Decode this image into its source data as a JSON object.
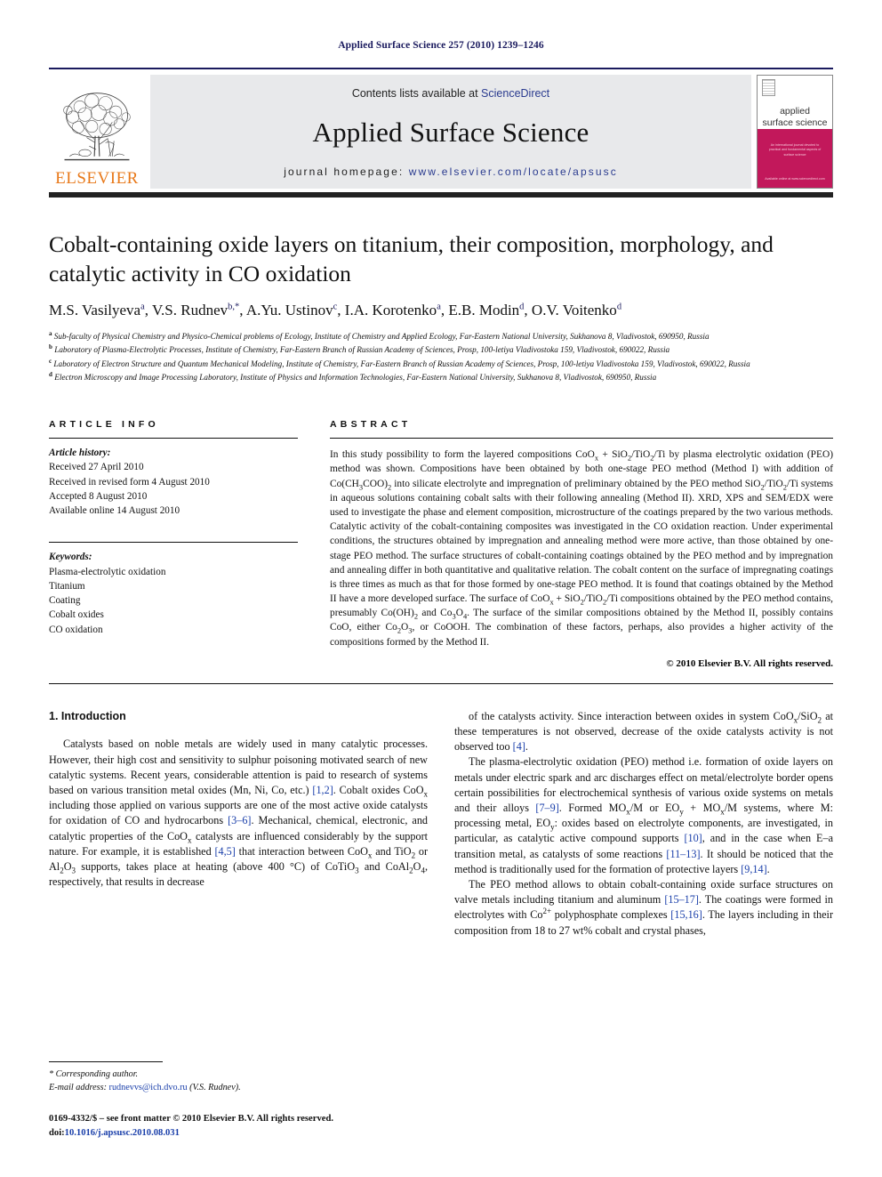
{
  "running_head": "Applied Surface Science 257 (2010) 1239–1246",
  "masthead": {
    "contents_prefix": "Contents lists available at ",
    "contents_link": "ScienceDirect",
    "journal_title": "Applied Surface Science",
    "homepage_prefix": "journal homepage: ",
    "homepage_url": "www.elsevier.com/locate/apsusc",
    "publisher": "ELSEVIER",
    "cover": {
      "line1": "applied",
      "line2": "surface science",
      "sub": "An international journal devoted to practical and fundamental aspects of surface science",
      "foot": "Available online at www.sciencedirect.com"
    }
  },
  "article": {
    "title": "Cobalt-containing oxide layers on titanium, their composition, morphology, and catalytic activity in CO oxidation",
    "authors_html": "M.S. Vasilyeva<sup>a</sup>, V.S. Rudnev<sup>b,*</sup>, A.Yu. Ustinov<sup>c</sup>, I.A. Korotenko<sup>a</sup>, E.B. Modin<sup>d</sup>, O.V. Voitenko<sup>d</sup>",
    "affiliations": [
      {
        "mark": "a",
        "text": "Sub-faculty of Physical Chemistry and Physico-Chemical problems of Ecology, Institute of Chemistry and Applied Ecology, Far-Eastern National University, Sukhanova 8, Vladivostok, 690950, Russia"
      },
      {
        "mark": "b",
        "text": "Laboratory of Plasma-Electrolytic Processes, Institute of Chemistry, Far-Eastern Branch of Russian Academy of Sciences, Prosp, 100-letiya Vladivostoka 159, Vladivostok, 690022, Russia"
      },
      {
        "mark": "c",
        "text": "Laboratory of Electron Structure and Quantum Mechanical Modeling, Institute of Chemistry, Far-Eastern Branch of Russian Academy of Sciences, Prosp, 100-letiya Vladivostoka 159, Vladivostok, 690022, Russia"
      },
      {
        "mark": "d",
        "text": "Electron Microscopy and Image Processing Laboratory, Institute of Physics and Information Technologies, Far-Eastern National University, Sukhanova 8, Vladivostok, 690950, Russia"
      }
    ]
  },
  "article_info": {
    "heading": "ARTICLE INFO",
    "history_label": "Article history:",
    "history": [
      "Received 27 April 2010",
      "Received in revised form 4 August 2010",
      "Accepted 8 August 2010",
      "Available online 14 August 2010"
    ],
    "keywords_label": "Keywords:",
    "keywords": [
      "Plasma-electrolytic oxidation",
      "Titanium",
      "Coating",
      "Cobalt oxides",
      "CO oxidation"
    ]
  },
  "abstract": {
    "heading": "ABSTRACT",
    "text_html": "In this study possibility to form the layered compositions CoO<sub>x</sub> + SiO<sub>2</sub>/TiO<sub>2</sub>/Ti by plasma electrolytic oxidation (PEO) method was shown. Compositions have been obtained by both one-stage PEO method (Method I) with addition of Co(CH<sub>3</sub>COO)<sub>2</sub> into silicate electrolyte and impregnation of preliminary obtained by the PEO method SiO<sub>2</sub>/TiO<sub>2</sub>/Ti systems in aqueous solutions containing cobalt salts with their following annealing (Method II). XRD, XPS and SEM/EDX were used to investigate the phase and element composition, microstructure of the coatings prepared by the two various methods. Catalytic activity of the cobalt-containing composites was investigated in the CO oxidation reaction. Under experimental conditions, the structures obtained by impregnation and annealing method were more active, than those obtained by one-stage PEO method. The surface structures of cobalt-containing coatings obtained by the PEO method and by impregnation and annealing differ in both quantitative and qualitative relation. The cobalt content on the surface of impregnating coatings is three times as much as that for those formed by one-stage PEO method. It is found that coatings obtained by the Method II have a more developed surface. The surface of CoO<sub>x</sub> + SiO<sub>2</sub>/TiO<sub>2</sub>/Ti compositions obtained by the PEO method contains, presumably Co(OH)<sub>2</sub> and Co<sub>3</sub>O<sub>4</sub>. The surface of the similar compositions obtained by the Method II, possibly contains CoO, either Co<sub>2</sub>O<sub>3</sub>, or CoOOH. The combination of these factors, perhaps, also provides a higher activity of the compositions formed by the Method II.",
    "copyright": "© 2010 Elsevier B.V. All rights reserved."
  },
  "intro": {
    "heading": "1.  Introduction",
    "left_html": "Catalysts based on noble metals are widely used in many catalytic processes. However, their high cost and sensitivity to sulphur poisoning motivated search of new catalytic systems. Recent years, considerable attention is paid to research of systems based on various transition metal oxides (Mn, Ni, Co, etc.) <span class=\"ref\">[1,2]</span>. Cobalt oxides CoO<sub>x</sub> including those applied on various supports are one of the most active oxide catalysts for oxidation of CO and hydrocarbons <span class=\"ref\">[3–6]</span>. Mechanical, chemical, electronic, and catalytic properties of the CoO<sub>x</sub> catalysts are influenced considerably by the support nature. For example, it is established <span class=\"ref\">[4,5]</span> that interaction between CoO<sub>x</sub> and TiO<sub>2</sub> or Al<sub>2</sub>O<sub>3</sub> supports, takes place at heating (above 400 °C) of CoTiO<sub>3</sub> and CoAl<sub>2</sub>O<sub>4</sub>, respectively, that results in decrease",
    "right_p1_html": "of the catalysts activity. Since interaction between oxides in system CoO<sub>x</sub>/SiO<sub>2</sub> at these temperatures is not observed, decrease of the oxide catalysts activity is not observed too <span class=\"ref\">[4]</span>.",
    "right_p2_html": "The plasma-electrolytic oxidation (PEO) method i.e. formation of oxide layers on metals under electric spark and arc discharges effect on metal/electrolyte border opens certain possibilities for electrochemical synthesis of various oxide systems on metals and their alloys <span class=\"ref\">[7–9]</span>. Formed MO<sub>x</sub>/M or EO<sub>y</sub> + MO<sub>x</sub>/M systems, where M: processing metal, EO<sub>y</sub>: oxides based on electrolyte components, are investigated, in particular, as catalytic active compound supports <span class=\"ref\">[10]</span>, and in the case when E–a transition metal, as catalysts of some reactions <span class=\"ref\">[11–13]</span>. It should be noticed that the method is traditionally used for the formation of protective layers <span class=\"ref\">[9,14]</span>.",
    "right_p3_html": "The PEO method allows to obtain cobalt-containing oxide surface structures on valve metals including titanium and aluminum <span class=\"ref\">[15–17]</span>. The coatings were formed in electrolytes with Co<sup>2+</sup> polyphosphate complexes <span class=\"ref\">[15,16]</span>. The layers including in their composition from 18 to 27 wt% cobalt and crystal phases,"
  },
  "footnotes": {
    "corresponding": "* Corresponding author.",
    "email_label": "E-mail address: ",
    "email": "rudnevvs@ich.dvo.ru",
    "email_suffix": " (V.S. Rudnev).",
    "front_matter": "0169-4332/$ – see front matter © 2010 Elsevier B.V. All rights reserved.",
    "doi_label": "doi:",
    "doi": "10.1016/j.apsusc.2010.08.031"
  }
}
